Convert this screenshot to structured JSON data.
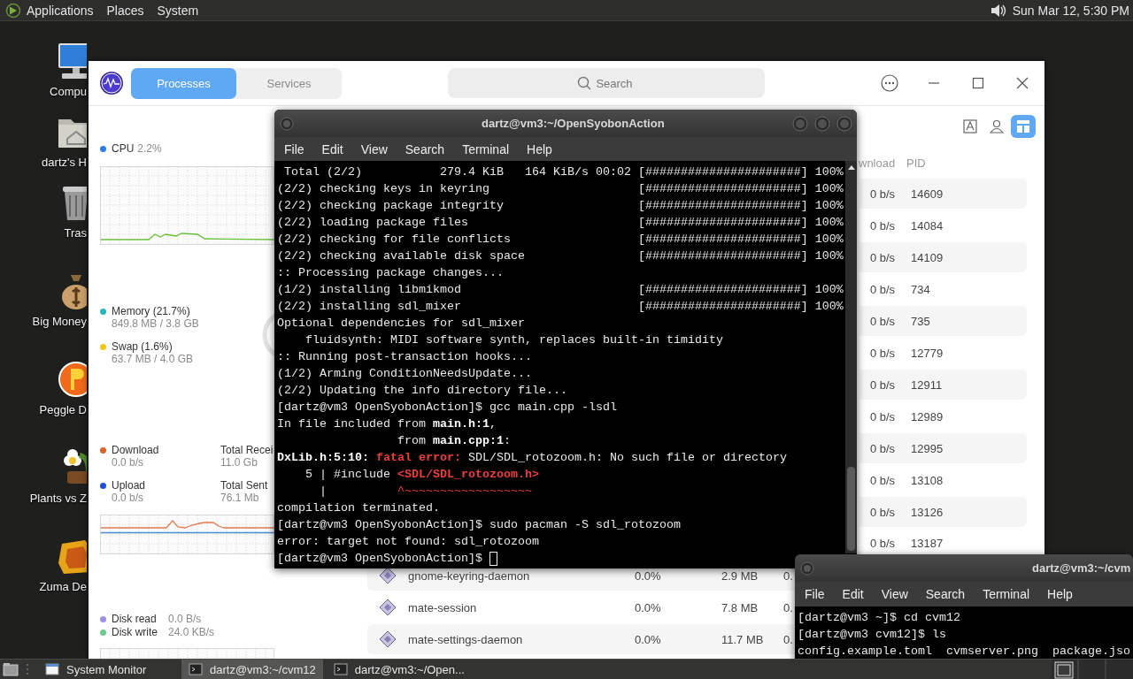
{
  "top_panel": {
    "menus": [
      "Applications",
      "Places",
      "System"
    ],
    "clock": "Sun Mar 12, 5:30 PM"
  },
  "desktop_icons": [
    {
      "label": "Compu",
      "kind": "computer"
    },
    {
      "label": "dartz's H",
      "kind": "home"
    },
    {
      "label": "Tras",
      "kind": "trash"
    },
    {
      "label": "Big Money",
      "kind": "moneybag"
    },
    {
      "label": "Peggle D",
      "kind": "ball"
    },
    {
      "label": "Plants vs Z",
      "kind": "flower"
    },
    {
      "label": "Zuma De",
      "kind": "block"
    }
  ],
  "system_monitor": {
    "tabs": [
      {
        "label": "Processes",
        "selected": true
      },
      {
        "label": "Services",
        "selected": false
      }
    ],
    "search": {
      "placeholder": "Search"
    },
    "cpu": {
      "label": "CPU",
      "value": "2.2%",
      "color": "#2b7de9"
    },
    "memory": [
      {
        "label": "Memory (21.7%)",
        "value": "849.8 MB / 3.8 GB",
        "color": "#2bb5b8"
      },
      {
        "label": "Swap (1.6%)",
        "value": "63.7 MB / 4.0 GB",
        "color": "#f5c518"
      }
    ],
    "network": [
      {
        "label": "Download",
        "value": "0.0 b/s",
        "color": "#d9642c",
        "total_label": "Total Recei",
        "total_value": "11.0 Gb"
      },
      {
        "label": "Upload",
        "value": "0.0 b/s",
        "color": "#1f4fd6",
        "total_label": "Total Sent",
        "total_value": "76.1 Mb"
      }
    ],
    "disk": [
      {
        "label": "Disk read",
        "value": "0.0 B/s",
        "color": "#9b8ee6"
      },
      {
        "label": "Disk write",
        "value": "24.0 KB/s",
        "color": "#6cca8c"
      }
    ],
    "view_buttons": [
      {
        "kind": "text",
        "selected": false
      },
      {
        "kind": "user",
        "selected": false
      },
      {
        "kind": "layout",
        "selected": true
      }
    ],
    "table": {
      "columns": [
        {
          "kind": "download",
          "label": "wnload"
        },
        {
          "kind": "pid",
          "label": "PID"
        }
      ],
      "rows": [
        {
          "download": "0 b/s",
          "pid": "14609"
        },
        {
          "download": "0 b/s",
          "pid": "14084"
        },
        {
          "download": "0 b/s",
          "pid": "14109"
        },
        {
          "download": "0 b/s",
          "pid": "734"
        },
        {
          "download": "0 b/s",
          "pid": "735"
        },
        {
          "download": "0 b/s",
          "pid": "12779"
        },
        {
          "download": "0 b/s",
          "pid": "12911"
        },
        {
          "download": "0 b/s",
          "pid": "12989"
        },
        {
          "download": "0 b/s",
          "pid": "12995"
        },
        {
          "download": "0 b/s",
          "pid": "13108"
        },
        {
          "download": "0 b/s",
          "pid": "13126"
        },
        {
          "download": "0 b/s",
          "pid": "13187"
        },
        {
          "name": "gnome-keyring-daemon",
          "cpu": "0.0%",
          "memory": "2.9 MB",
          "column_5": "0."
        },
        {
          "name": "mate-session",
          "cpu": "0.0%",
          "memory": "7.8 MB",
          "column_5": "0."
        },
        {
          "name": "mate-settings-daemon",
          "cpu": "0.0%",
          "memory": "11.7 MB",
          "column_5": "0."
        }
      ]
    }
  },
  "terminals": [
    {
      "title": "dartz@vm3:~/OpenSyobonAction",
      "menu": [
        "File",
        "Edit",
        "View",
        "Search",
        "Terminal",
        "Help"
      ],
      "lines": [
        {
          "text": " Total (2/2)           279.4 KiB   164 KiB/s 00:02 [######################] 100%"
        },
        {
          "text": "(2/2) checking keys in keyring                     [######################] 100%"
        },
        {
          "text": "(2/2) checking package integrity                   [######################] 100%"
        },
        {
          "text": "(2/2) loading package files                        [######################] 100%"
        },
        {
          "text": "(2/2) checking for file conflicts                  [######################] 100%"
        },
        {
          "text": "(2/2) checking available disk space                [######################] 100%"
        },
        {
          "text": ":: Processing package changes..."
        },
        {
          "text": "(1/2) installing libmikmod                         [######################] 100%"
        },
        {
          "text": "(2/2) installing sdl_mixer                         [######################] 100%"
        },
        {
          "text": "Optional dependencies for sdl_mixer"
        },
        {
          "text": "    fluidsynth: MIDI software synth, replaces built-in timidity"
        },
        {
          "text": ":: Running post-transaction hooks..."
        },
        {
          "text": "(1/2) Arming ConditionNeedsUpdate..."
        },
        {
          "text": "(2/2) Updating the info directory file..."
        },
        {
          "text": "[dartz@vm3 OpenSyobonAction]$ gcc main.cpp -lsdl"
        },
        {
          "segments": [
            {
              "text": "In file included from ",
              "kind": "plain"
            },
            {
              "text": "main.h:1",
              "kind": "bold"
            },
            {
              "text": ",",
              "kind": "plain"
            }
          ]
        },
        {
          "segments": [
            {
              "text": "                 from ",
              "kind": "plain"
            },
            {
              "text": "main.cpp:1",
              "kind": "bold"
            },
            {
              "text": ":",
              "kind": "plain"
            }
          ]
        },
        {
          "segments": [
            {
              "text": "DxLib.h:5:10: ",
              "kind": "bold"
            },
            {
              "text": "fatal error:",
              "kind": "error"
            },
            {
              "text": " SDL/SDL_rotozoom.h: No such file or directory",
              "kind": "plain"
            }
          ]
        },
        {
          "segments": [
            {
              "text": "    5 | #include ",
              "kind": "plain"
            },
            {
              "text": "<SDL/SDL_rotozoom.h>",
              "kind": "error"
            }
          ]
        },
        {
          "segments": [
            {
              "text": "      |          ",
              "kind": "plain"
            },
            {
              "text": "^~~~~~~~~~~~~~~~~~~",
              "kind": "mark"
            }
          ]
        },
        {
          "text": "compilation terminated."
        },
        {
          "text": "[dartz@vm3 OpenSyobonAction]$ sudo pacman -S sdl_rotozoom"
        },
        {
          "text": "error: target not found: sdl_rotozoom"
        },
        {
          "text": "[dartz@vm3 OpenSyobonAction]$ ",
          "cursor": true
        }
      ]
    },
    {
      "title": "dartz@vm3:~/cvm",
      "menu": [
        "File",
        "Edit",
        "View",
        "Search",
        "Terminal",
        "Help"
      ],
      "lines": [
        {
          "text": "[dartz@vm3 ~]$ cd cvm12"
        },
        {
          "text": "[dartz@vm3 cvm12]$ ls"
        },
        {
          "text": "config.example.toml  cvmserver.png  package.jso"
        }
      ]
    }
  ],
  "taskbar": {
    "windows": [
      {
        "label": "System Monitor",
        "kind": "window",
        "selected": false
      },
      {
        "label": "dartz@vm3:~/cvm12",
        "kind": "terminal",
        "selected": true
      },
      {
        "label": "dartz@vm3:~/Open...",
        "kind": "terminal",
        "selected": false
      }
    ]
  }
}
